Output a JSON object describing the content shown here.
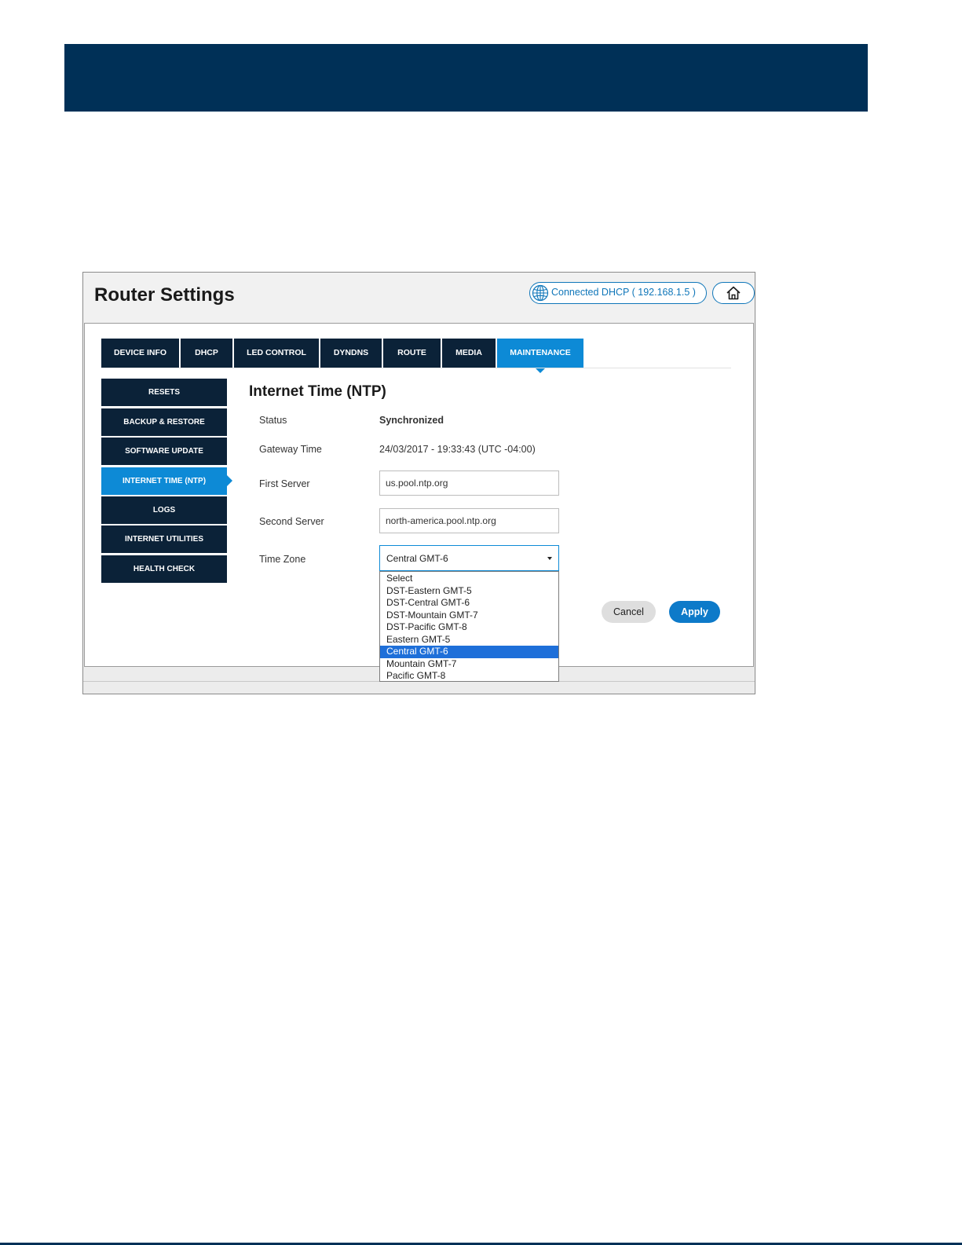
{
  "colors": {
    "banner": "#003057",
    "nav_dark": "#0b2238",
    "nav_active": "#0d8ad6",
    "accent": "#0f76b9",
    "selected_option": "#1e6fd9"
  },
  "header": {
    "title": "Router Settings",
    "connection_label": "Connected  DHCP  ( 192.168.1.5 )",
    "connection_icon": "globe-icon",
    "home_icon": "home-icon"
  },
  "tabs": [
    {
      "label": "DEVICE INFO",
      "active": false
    },
    {
      "label": "DHCP",
      "active": false
    },
    {
      "label": "LED CONTROL",
      "active": false
    },
    {
      "label": "DYNDNS",
      "active": false
    },
    {
      "label": "ROUTE",
      "active": false
    },
    {
      "label": "MEDIA",
      "active": false
    },
    {
      "label": "MAINTENANCE",
      "active": true
    }
  ],
  "sidebar": {
    "items": [
      {
        "label": "RESETS",
        "active": false
      },
      {
        "label": "BACKUP & RESTORE",
        "active": false
      },
      {
        "label": "SOFTWARE UPDATE",
        "active": false
      },
      {
        "label": "INTERNET TIME (NTP)",
        "active": true
      },
      {
        "label": "LOGS",
        "active": false
      },
      {
        "label": "INTERNET UTILITIES",
        "active": false
      },
      {
        "label": "HEALTH CHECK",
        "active": false
      }
    ]
  },
  "ntp": {
    "title": "Internet Time (NTP)",
    "status_label": "Status",
    "status_value": "Synchronized",
    "gateway_time_label": "Gateway Time",
    "gateway_time_value": "24/03/2017 - 19:33:43 (UTC -04:00)",
    "first_server_label": "First Server",
    "first_server_value": "us.pool.ntp.org",
    "second_server_label": "Second Server",
    "second_server_value": "north-america.pool.ntp.org",
    "time_zone_label": "Time Zone",
    "time_zone_value": "Central GMT-6",
    "time_zone_options": [
      "Select",
      "DST-Eastern GMT-5",
      "DST-Central GMT-6",
      "DST-Mountain GMT-7",
      "DST-Pacific GMT-8",
      "Eastern GMT-5",
      "Central GMT-6",
      "Mountain GMT-7",
      "Pacific GMT-8"
    ],
    "time_zone_selected_index": 6
  },
  "actions": {
    "cancel_label": "Cancel",
    "apply_label": "Apply"
  }
}
